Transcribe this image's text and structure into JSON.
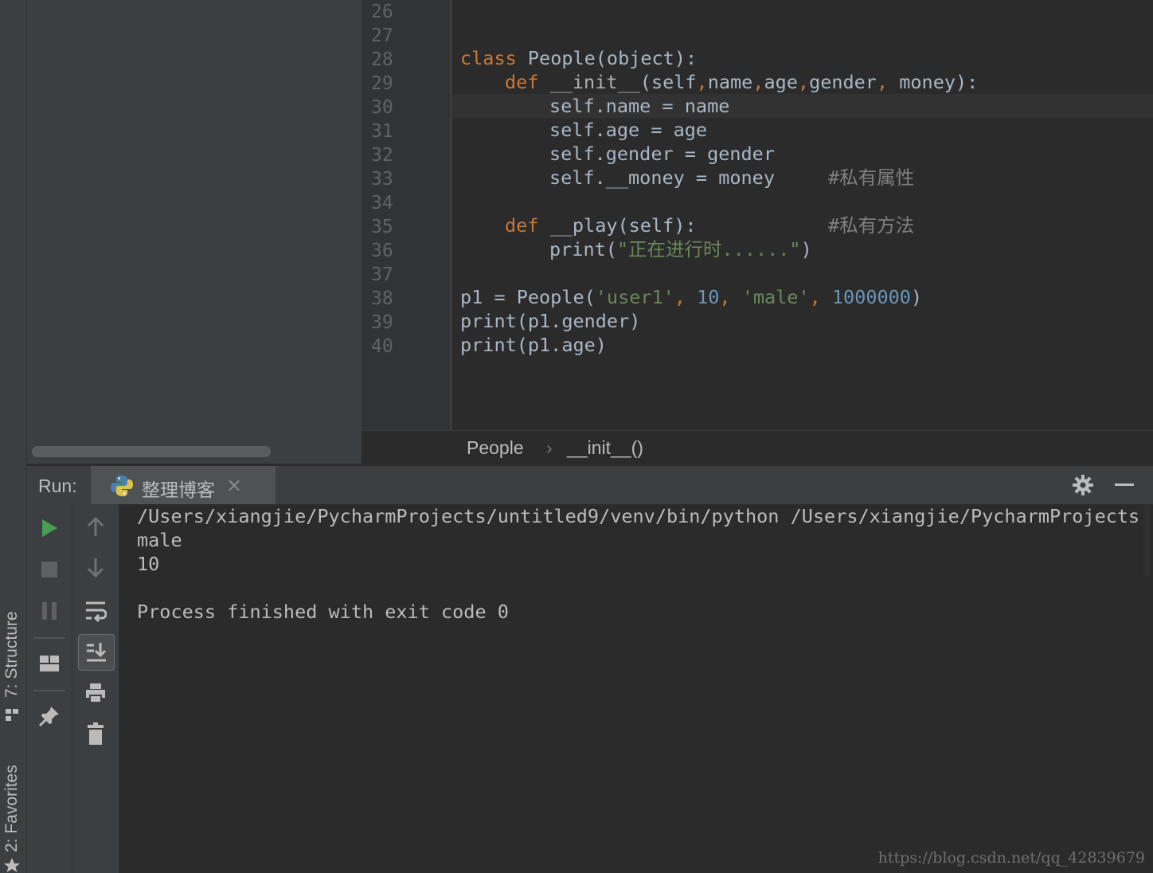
{
  "sidebar": {
    "structure_tab": "7: Structure",
    "favorites_tab": "2: Favorites"
  },
  "editor": {
    "lines": [
      {
        "n": "26"
      },
      {
        "n": "27"
      },
      {
        "n": "28"
      },
      {
        "n": "29"
      },
      {
        "n": "30"
      },
      {
        "n": "31"
      },
      {
        "n": "32"
      },
      {
        "n": "33"
      },
      {
        "n": "34"
      },
      {
        "n": "35"
      },
      {
        "n": "36"
      },
      {
        "n": "37"
      },
      {
        "n": "38"
      },
      {
        "n": "39"
      },
      {
        "n": "40"
      }
    ],
    "code": {
      "l28": {
        "kw": "class",
        "rest": " People(object):"
      },
      "l29": {
        "kw": "def",
        "name": " __init__",
        "params": "(self",
        "c1": ",",
        "p2": "name",
        "c2": ",",
        "p3": "age",
        "c3": ",",
        "p4": "gender",
        "c4": ",",
        "p5": " money):"
      },
      "l30": "self.name = name",
      "l31": "self.age = age",
      "l32": "self.gender = gender",
      "l33": {
        "code": "self.__money = money",
        "comment": "#私有属性"
      },
      "l35": {
        "kw": "def",
        "rest": " __play(self):",
        "comment": "#私有方法"
      },
      "l36": {
        "pre": "print(",
        "str": "\"正在进行时......\"",
        "post": ")"
      },
      "l38": {
        "pre": "p1 = People(",
        "s1": "'user1'",
        "c1": ", ",
        "n1": "10",
        "c2": ", ",
        "s2": "'male'",
        "c3": ", ",
        "n2": "1000000",
        "post": ")"
      },
      "l39": "print(p1.gender)",
      "l40": "print(p1.age)"
    }
  },
  "breadcrumb": {
    "class": "People",
    "separator": "›",
    "method": "__init__()"
  },
  "run": {
    "label": "Run:",
    "tab_name": "整理博客",
    "tab_close": "×"
  },
  "console": {
    "lines": [
      "/Users/xiangjie/PycharmProjects/untitled9/venv/bin/python /Users/xiangjie/PycharmProjects",
      "male",
      "10",
      "",
      "Process finished with exit code 0"
    ],
    "watermark": "https://blog.csdn.net/qq_42839679"
  },
  "colors": {
    "keyword": "#cc7832",
    "string": "#6a8759",
    "number": "#6897bb",
    "comment": "#808080",
    "text": "#a9b7c6",
    "run_green": "#499c54"
  }
}
